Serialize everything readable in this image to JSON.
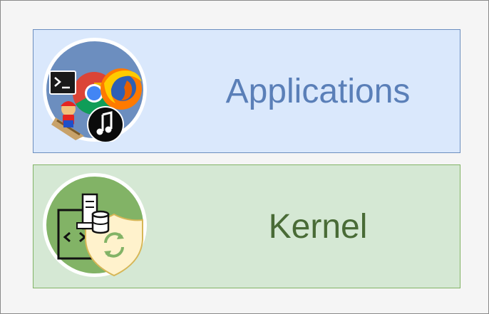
{
  "layers": [
    {
      "id": "applications",
      "label": "Applications",
      "fill": "#dae8fc",
      "border": "#6c8ebf",
      "text_color": "#5a7fb8",
      "icons": [
        "terminal-icon",
        "chrome-icon",
        "firefox-icon",
        "mario-game-icon",
        "music-note-icon"
      ]
    },
    {
      "id": "kernel",
      "label": "Kernel",
      "fill": "#d5e8d4",
      "border": "#82b366",
      "text_color": "#496b36",
      "icons": [
        "code-file-icon",
        "server-database-icon",
        "shield-refresh-icon"
      ]
    }
  ]
}
